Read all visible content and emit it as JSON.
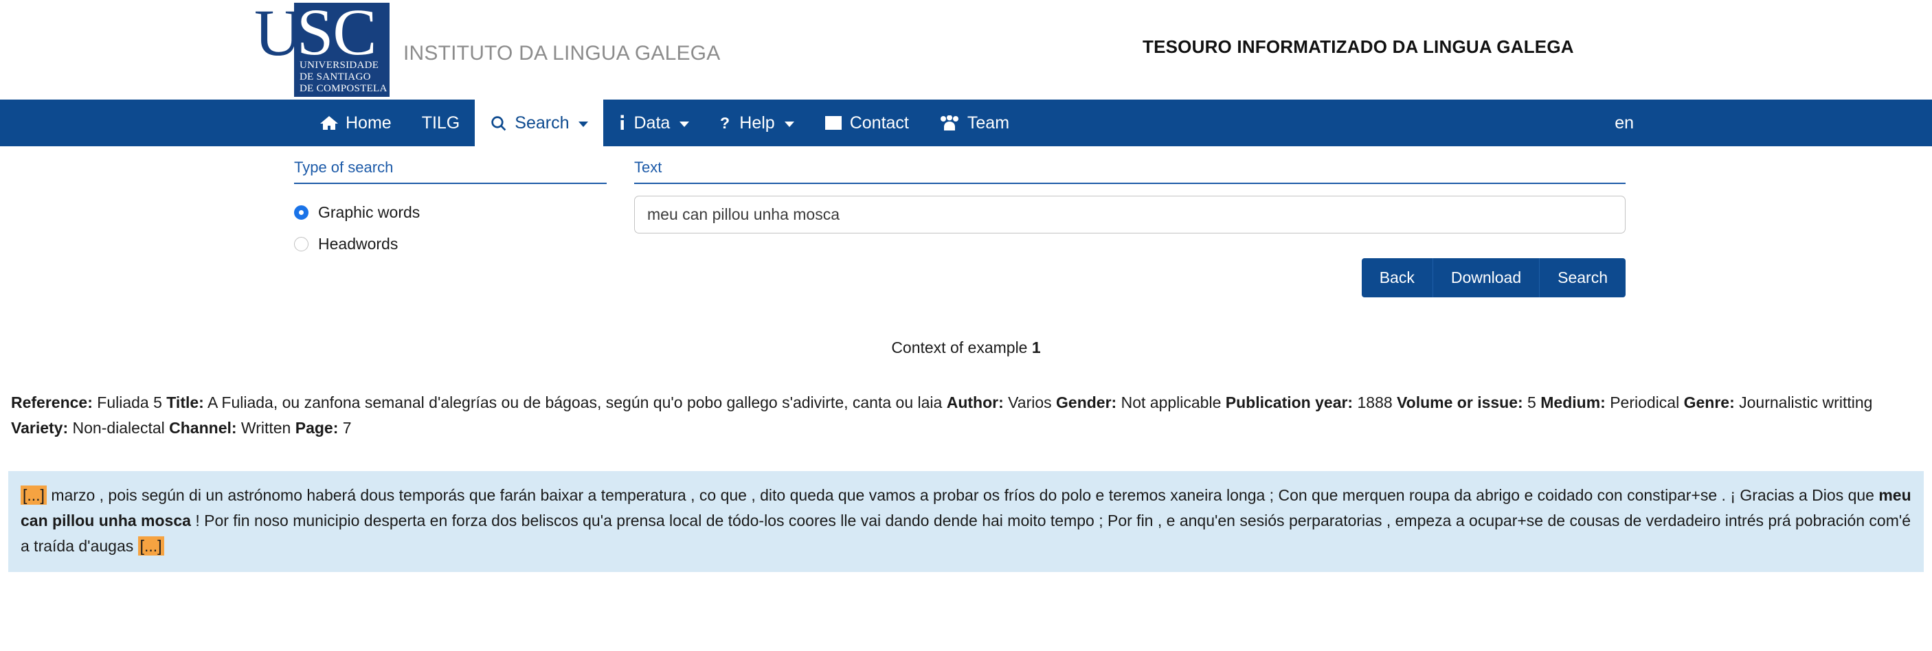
{
  "header": {
    "logo": {
      "letter_u": "U",
      "letter_sc": "SC",
      "sub_line1": "UNIVERSIDADE",
      "sub_line2": "DE SANTIAGO",
      "sub_line3": "DE COMPOSTELA",
      "icon_name": "usc-logo"
    },
    "institute_name": "INSTITUTO DA LINGUA GALEGA",
    "site_title": "TESOURO INFORMATIZADO DA LINGUA GALEGA"
  },
  "nav": {
    "items": [
      {
        "label": "Home",
        "icon": "home-icon",
        "caret": false,
        "active": false
      },
      {
        "label": "TILG",
        "icon": "",
        "caret": false,
        "active": false
      },
      {
        "label": "Search",
        "icon": "search-icon",
        "caret": true,
        "active": true
      },
      {
        "label": "Data",
        "icon": "info-icon",
        "caret": true,
        "active": false
      },
      {
        "label": "Help",
        "icon": "question-icon",
        "caret": true,
        "active": false
      },
      {
        "label": "Contact",
        "icon": "inbox-icon",
        "caret": false,
        "active": false
      },
      {
        "label": "Team",
        "icon": "users-icon",
        "caret": false,
        "active": false
      }
    ],
    "language": "en"
  },
  "form": {
    "type_label": "Type of search",
    "options": [
      {
        "label": "Graphic words",
        "checked": true
      },
      {
        "label": "Headwords",
        "checked": false
      }
    ],
    "text_label": "Text",
    "text_value": "meu can pillou unha mosca",
    "text_placeholder": "",
    "buttons": {
      "back": "Back",
      "download": "Download",
      "search": "Search"
    }
  },
  "results": {
    "context_heading_prefix": "Context of example ",
    "context_heading_number": "1",
    "metadata": [
      {
        "key": "Reference:",
        "value": "Fuliada 5"
      },
      {
        "key": "Title:",
        "value": "A Fuliada, ou zanfona semanal d'alegrías ou de bágoas, según qu'o pobo gallego s'adivirte, canta ou laia"
      },
      {
        "key": "Author:",
        "value": "Varios"
      },
      {
        "key": "Gender:",
        "value": "Not applicable"
      },
      {
        "key": "Publication year:",
        "value": "1888"
      },
      {
        "key": "Volume or issue:",
        "value": "5"
      },
      {
        "key": "Medium:",
        "value": "Periodical"
      },
      {
        "key": "Genre:",
        "value": "Journalistic writting"
      },
      {
        "key": "Variety:",
        "value": "Non-dialectal"
      },
      {
        "key": "Channel:",
        "value": "Written"
      },
      {
        "key": "Page:",
        "value": "7"
      }
    ],
    "excerpt": {
      "ellipsis_marker": "[...]",
      "part1": " marzo , pois según di un astrónomo haberá dous temporás que farán baixar a temperatura , co que , dito queda que vamos a probar os fríos do polo e teremos xaneira longa ; Con que merquen roupa da abrigo e coidado con constipar+se . ¡ Gracias a Dios que ",
      "hit": "meu can pillou unha mosca",
      "part2": " ! Por fin noso municipio desperta en forza dos beliscos qu'a prensa local de tódo-los coores lle vai dando dende hai moito tempo ; Por fin , e anqu'en sesiós perparatorias , empeza a ocupar+se de cousas de verdadeiro intrés prá pobración com'é a traída d'augas "
    }
  },
  "colors": {
    "brand_blue": "#0d4a8f",
    "logo_blue": "#17407f",
    "label_blue": "#1c5aa8",
    "highlight_bg": "#d7e9f5",
    "ellipsis_bg": "#f6a341",
    "radio_blue": "#1a73e8"
  }
}
